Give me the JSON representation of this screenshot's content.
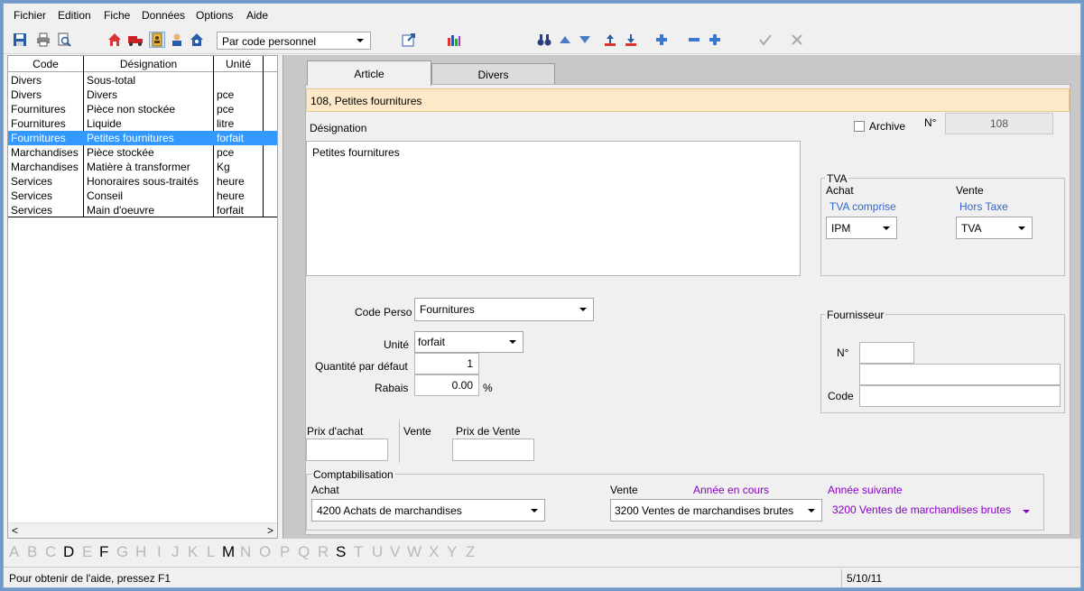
{
  "menu": [
    "Fichier",
    "Edition",
    "Fiche",
    "Données",
    "Options",
    "Aide"
  ],
  "toolbar": {
    "sort_select": "Par code personnel",
    "icons": [
      "save-icon",
      "print-icon",
      "print-preview-icon",
      "home-icon",
      "truck-icon",
      "address-book-icon",
      "user-icon",
      "house-user-icon",
      "export-icon",
      "chart-icon",
      "binoculars-icon",
      "arrow-up-icon",
      "arrow-down-icon",
      "sort-up-icon",
      "sort-down-icon",
      "add-icon",
      "minus-icon",
      "add-record-icon",
      "check-icon",
      "cancel-icon"
    ]
  },
  "list": {
    "headers": [
      "Code",
      "Désignation",
      "Unité"
    ],
    "rows": [
      {
        "code": "Divers",
        "designation": "Sous-total",
        "unite": ""
      },
      {
        "code": "Divers",
        "designation": "Divers",
        "unite": "pce"
      },
      {
        "code": "Fournitures",
        "designation": "Pièce non stockée",
        "unite": "pce"
      },
      {
        "code": "Fournitures",
        "designation": "Liquide",
        "unite": "litre"
      },
      {
        "code": "Fournitures",
        "designation": "Petites fournitures",
        "unite": "forfait"
      },
      {
        "code": "Marchandises",
        "designation": "Pièce stockée",
        "unite": "pce"
      },
      {
        "code": "Marchandises",
        "designation": "Matière à transformer",
        "unite": "Kg"
      },
      {
        "code": "Services",
        "designation": "Honoraires sous-traités",
        "unite": "heure"
      },
      {
        "code": "Services",
        "designation": "Conseil",
        "unite": "heure"
      },
      {
        "code": "Services",
        "designation": "Main d'oeuvre",
        "unite": "forfait"
      }
    ],
    "selected_index": 4
  },
  "scroll": {
    "left": "<",
    "right": ">"
  },
  "alphabet": [
    "A",
    "B",
    "C",
    "D",
    "E",
    "F",
    "G",
    "H",
    "I",
    "J",
    "K",
    "L",
    "M",
    "N",
    "O",
    "P",
    "Q",
    "R",
    "S",
    "T",
    "U",
    "V",
    "W",
    "X",
    "Y",
    "Z"
  ],
  "alphabet_active": [
    "D",
    "F",
    "M",
    "S"
  ],
  "tabs": {
    "article": "Article",
    "divers": "Divers"
  },
  "form": {
    "header": "108, Petites fournitures",
    "designation_label": "Désignation",
    "archive_label": "Archive",
    "numero_label": "N°",
    "numero_value": "108",
    "designation_value": "Petites fournitures",
    "tva": {
      "title": "TVA",
      "achat_label": "Achat",
      "vente_label": "Vente",
      "achat_mode": "TVA comprise",
      "vente_mode": "Hors Taxe",
      "achat_value": "IPM",
      "vente_value": "TVA"
    },
    "code_perso_label": "Code Perso",
    "code_perso_value": "Fournitures",
    "unite_label": "Unité",
    "unite_value": "forfait",
    "quantite_label": "Quantité par défaut",
    "quantite_value": "1",
    "rabais_label": "Rabais",
    "rabais_value": "0.00",
    "rabais_unit": "%",
    "fournisseur": {
      "title": "Fournisseur",
      "numero_label": "N°",
      "code_label": "Code"
    },
    "prix_achat_label": "Prix d'achat",
    "vente_label": "Vente",
    "prix_vente_label": "Prix de Vente",
    "compta": {
      "title": "Comptabilisation",
      "achat_label": "Achat",
      "vente_label": "Vente",
      "annee_cours": "Année en cours",
      "annee_suivante": "Année suivante",
      "achat_value": "4200 Achats de marchandises",
      "vente_value": "3200 Ventes de marchandises brutes",
      "vente_suivante_value": "3200 Ventes de marchandises brutes"
    }
  },
  "status": {
    "help": "Pour obtenir de l'aide, pressez F1",
    "date": "5/10/11"
  },
  "colors": {
    "selection": "#3399ff",
    "header_bg": "#fde9c8",
    "blue_label": "#3366cc",
    "purple_label": "#8b00c4"
  }
}
